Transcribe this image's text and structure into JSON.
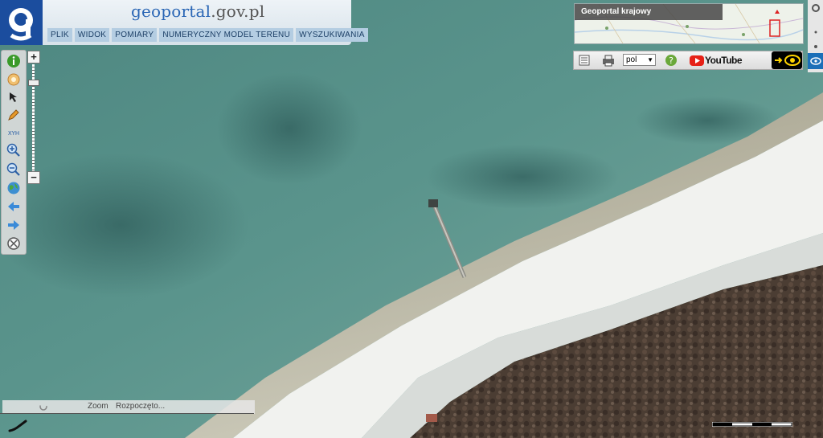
{
  "header": {
    "title_part1": "geo",
    "title_part2": "portal",
    "title_part3": ".gov.pl",
    "menu": [
      {
        "label": "PLIK"
      },
      {
        "label": "WIDOK"
      },
      {
        "label": "POMIARY"
      },
      {
        "label": "NUMERYCZNY MODEL TERENU"
      },
      {
        "label": "WYSZUKIWANIA"
      }
    ]
  },
  "minimap": {
    "title": "Geoportal krajowy"
  },
  "toolbar": {
    "language": "pol",
    "youtube_label": "YouTube"
  },
  "status": {
    "zoom_label": "Zoom",
    "progress_text": "Rozpoczęto..."
  },
  "colors": {
    "sea": "#4f8c84",
    "beach": "#f0f1ee",
    "forest": "#4a3c33",
    "brand": "#1b4d9e"
  }
}
